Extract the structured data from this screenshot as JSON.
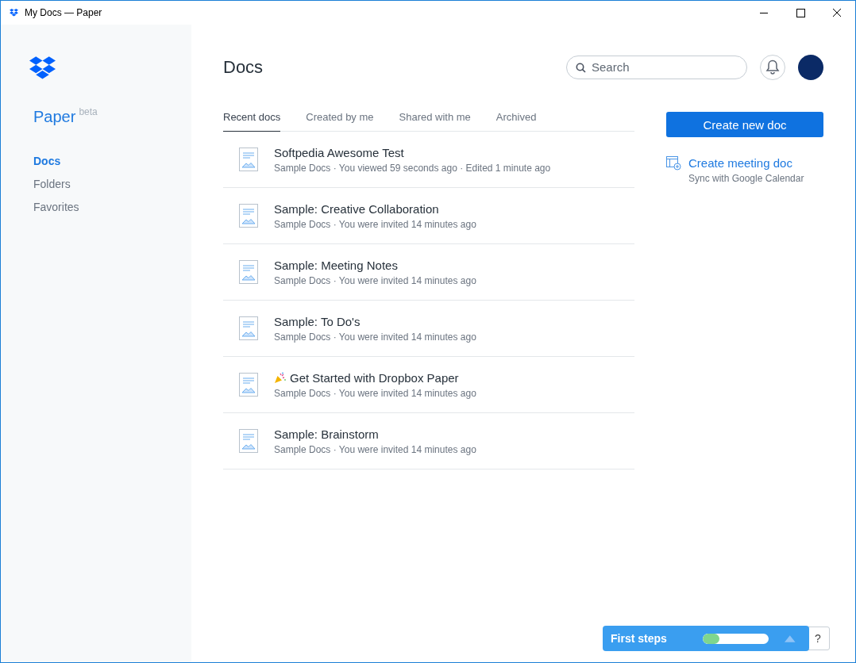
{
  "window": {
    "title": "My Docs — Paper"
  },
  "sidebar": {
    "brand": "Paper",
    "brand_badge": "beta",
    "items": [
      {
        "label": "Docs",
        "selected": true
      },
      {
        "label": "Folders",
        "selected": false
      },
      {
        "label": "Favorites",
        "selected": false
      }
    ]
  },
  "header": {
    "title": "Docs",
    "search": {
      "placeholder": "Search"
    }
  },
  "tabs": [
    {
      "label": "Recent docs",
      "selected": true
    },
    {
      "label": "Created by me",
      "selected": false
    },
    {
      "label": "Shared with me",
      "selected": false
    },
    {
      "label": "Archived",
      "selected": false
    }
  ],
  "docs": [
    {
      "kind": "plain",
      "title": "Softpedia Awesome Test",
      "meta": "Sample Docs · You viewed 59 seconds ago · Edited 1 minute ago"
    },
    {
      "kind": "plain",
      "title": "Sample: Creative Collaboration",
      "meta": "Sample Docs · You were invited 14 minutes ago"
    },
    {
      "kind": "plain",
      "title": "Sample: Meeting Notes",
      "meta": "Sample Docs · You were invited 14 minutes ago"
    },
    {
      "kind": "plain",
      "title": "Sample: To Do's",
      "meta": "Sample Docs · You were invited 14 minutes ago"
    },
    {
      "kind": "celebration",
      "title": "Get Started with Dropbox Paper",
      "meta": "Sample Docs · You were invited 14 minutes ago"
    },
    {
      "kind": "plain",
      "title": "Sample: Brainstorm",
      "meta": "Sample Docs · You were invited 14 minutes ago"
    }
  ],
  "actions": {
    "create_button": "Create new doc",
    "meeting_link": "Create meeting doc",
    "meeting_hint": "Sync with Google Calendar"
  },
  "first_steps": {
    "label": "First steps",
    "level": 0.25,
    "help": "?"
  }
}
